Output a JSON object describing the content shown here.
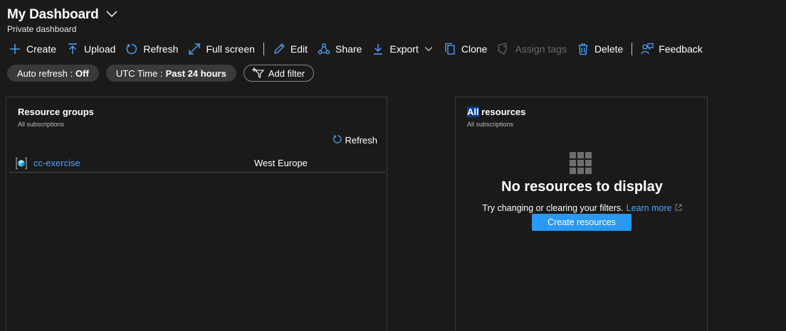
{
  "header": {
    "title": "My Dashboard",
    "subtitle": "Private dashboard"
  },
  "toolbar": {
    "create": "Create",
    "upload": "Upload",
    "refresh": "Refresh",
    "full_screen": "Full screen",
    "edit": "Edit",
    "share": "Share",
    "export": "Export",
    "clone": "Clone",
    "assign_tags": "Assign tags",
    "delete": "Delete",
    "feedback": "Feedback"
  },
  "filters": {
    "auto_refresh_label": "Auto refresh : ",
    "auto_refresh_value": "Off",
    "time_label": "UTC Time : ",
    "time_value": "Past 24 hours",
    "add_filter": "Add filter"
  },
  "resource_groups": {
    "title": "Resource groups",
    "subtitle": "All subscriptions",
    "refresh": "Refresh",
    "rows": [
      {
        "name": "cc-exercise",
        "location": "West Europe"
      }
    ]
  },
  "all_resources": {
    "title_highlight": "All",
    "title_rest": " resources",
    "subtitle": "All subscriptions",
    "empty_title": "No resources to display",
    "empty_message": "Try changing or clearing your filters.",
    "learn_more": "Learn more",
    "create_button": "Create resources"
  },
  "colors": {
    "background": "#1b1a19",
    "link": "#4da3ff",
    "primary_button": "#2899f5",
    "pill": "#3b3a39"
  }
}
